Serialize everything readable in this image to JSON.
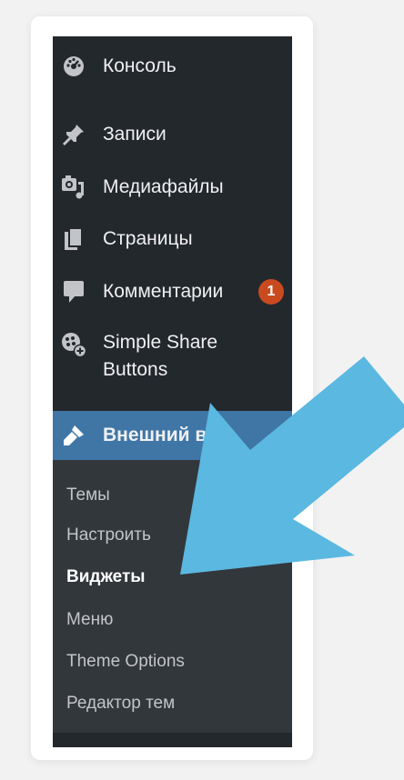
{
  "menu": {
    "items": [
      {
        "label": "Консоль",
        "icon": "dashboard-icon"
      },
      {
        "label": "Записи",
        "icon": "pin-icon"
      },
      {
        "label": "Медиафайлы",
        "icon": "media-icon"
      },
      {
        "label": "Страницы",
        "icon": "pages-icon"
      },
      {
        "label": "Комментарии",
        "icon": "comment-icon",
        "badge": "1"
      },
      {
        "label_line1": "Simple Share",
        "label_line2": "Buttons",
        "icon": "share-buttons-icon"
      },
      {
        "label": "Внешний вид",
        "icon": "appearance-brush-icon",
        "active": true
      }
    ],
    "submenu": [
      {
        "label": "Темы"
      },
      {
        "label": "Настроить"
      },
      {
        "label": "Виджеты",
        "current": true
      },
      {
        "label": "Меню"
      },
      {
        "label": "Theme Options"
      },
      {
        "label": "Редактор тем"
      }
    ]
  },
  "colors": {
    "sidebar_bg": "#23282d",
    "submenu_bg": "#32373c",
    "active_bg": "#3f76a6",
    "badge_bg": "#ca4a1f",
    "arrow": "#5bb8e0"
  }
}
